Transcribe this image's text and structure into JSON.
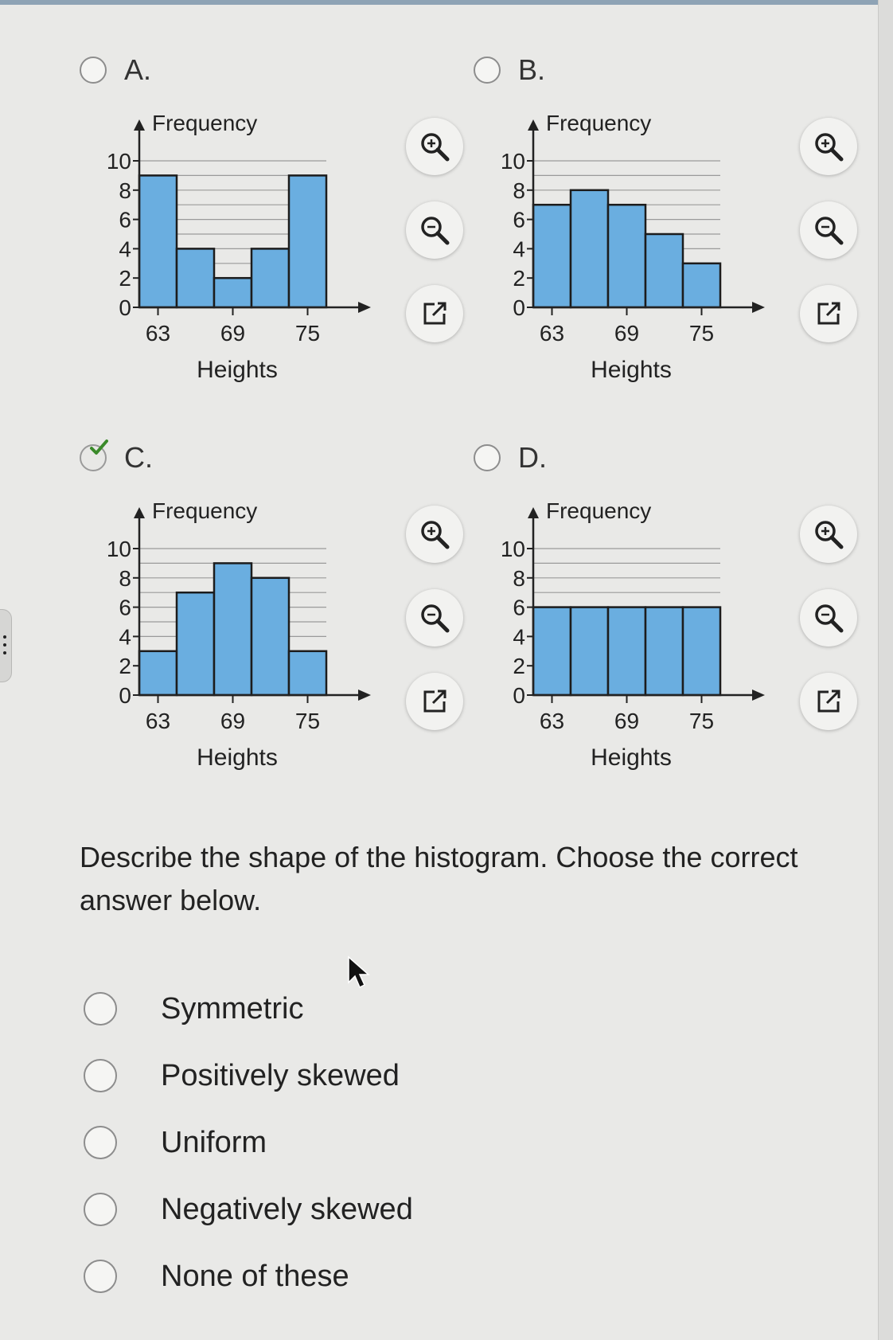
{
  "options": [
    {
      "letter": "A.",
      "selected": false
    },
    {
      "letter": "B.",
      "selected": false
    },
    {
      "letter": "C.",
      "selected": true
    },
    {
      "letter": "D.",
      "selected": false
    }
  ],
  "chart_data": [
    {
      "type": "bar",
      "title": "",
      "xlabel": "Heights",
      "ylabel": "Frequency",
      "x_ticks": [
        "63",
        "69",
        "75"
      ],
      "y_ticks": [
        "0",
        "2",
        "4",
        "6",
        "8",
        "10"
      ],
      "ylim": [
        0,
        10
      ],
      "values": [
        9,
        4,
        2,
        4,
        9
      ]
    },
    {
      "type": "bar",
      "title": "",
      "xlabel": "Heights",
      "ylabel": "Frequency",
      "x_ticks": [
        "63",
        "69",
        "75"
      ],
      "y_ticks": [
        "0",
        "2",
        "4",
        "6",
        "8",
        "10"
      ],
      "ylim": [
        0,
        10
      ],
      "values": [
        7,
        8,
        7,
        5,
        3
      ]
    },
    {
      "type": "bar",
      "title": "",
      "xlabel": "Heights",
      "ylabel": "Frequency",
      "x_ticks": [
        "63",
        "69",
        "75"
      ],
      "y_ticks": [
        "0",
        "2",
        "4",
        "6",
        "8",
        "10"
      ],
      "ylim": [
        0,
        10
      ],
      "values": [
        3,
        7,
        9,
        8,
        3
      ]
    },
    {
      "type": "bar",
      "title": "",
      "xlabel": "Heights",
      "ylabel": "Frequency",
      "x_ticks": [
        "63",
        "69",
        "75"
      ],
      "y_ticks": [
        "0",
        "2",
        "4",
        "6",
        "8",
        "10"
      ],
      "ylim": [
        0,
        10
      ],
      "values": [
        6,
        6,
        6,
        6,
        6
      ]
    }
  ],
  "question": {
    "text": "Describe the shape of the histogram. Choose the correct answer below."
  },
  "answers": [
    {
      "label": "Symmetric"
    },
    {
      "label": "Positively skewed"
    },
    {
      "label": "Uniform"
    },
    {
      "label": "Negatively skewed"
    },
    {
      "label": "None of these"
    }
  ],
  "colors": {
    "bar": "#6aaee0",
    "bar_edge": "#1c1c1c",
    "accent_check": "#3a8a2a"
  },
  "icons": [
    "zoom-in-icon",
    "zoom-out-icon",
    "open-new-window-icon"
  ]
}
